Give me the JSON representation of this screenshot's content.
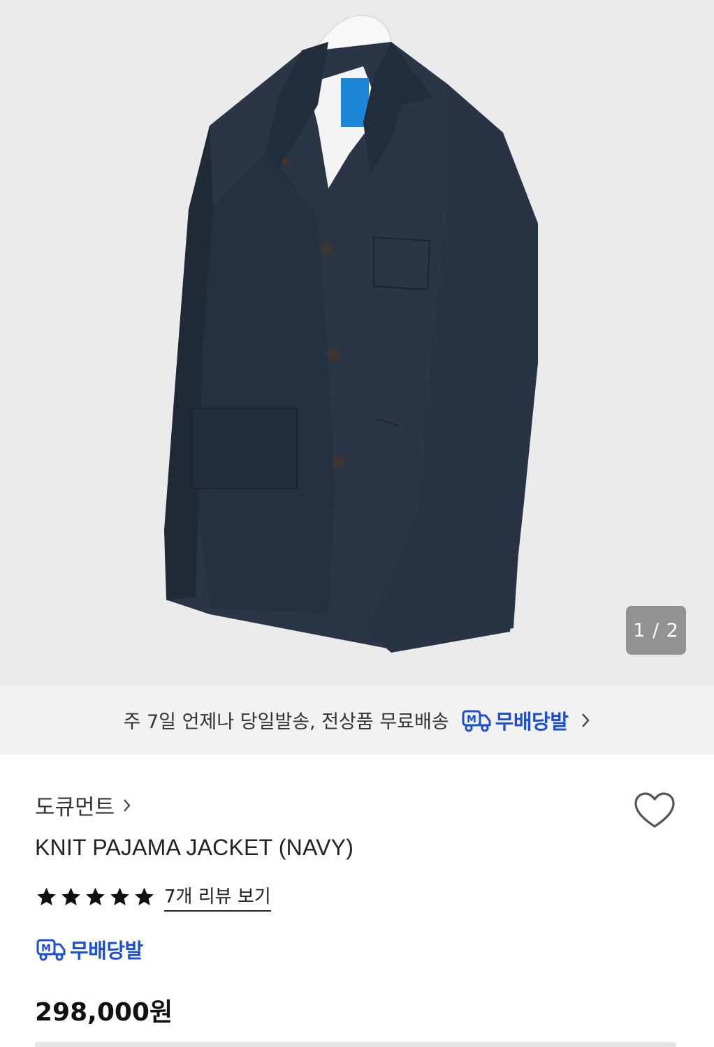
{
  "gallery": {
    "image_alt": "KNIT PAJAMA JACKET (NAVY)",
    "counter": "1 / 2"
  },
  "banner": {
    "text": "주 7일 언제나 당일발송, 전상품 무료배송",
    "badge_label": "무배당발",
    "icon": "chevron-right-icon"
  },
  "product": {
    "brand": "도큐먼트",
    "title": "KNIT PAJAMA JACKET (NAVY)",
    "rating": 5,
    "review_link": "7개 리뷰 보기",
    "badge_label": "무배당발",
    "price": "298,000원",
    "wishlist_icon": "heart-outline-icon"
  },
  "colors": {
    "brand_blue": "#1d4fd6",
    "jacket_navy": "#25303f"
  }
}
